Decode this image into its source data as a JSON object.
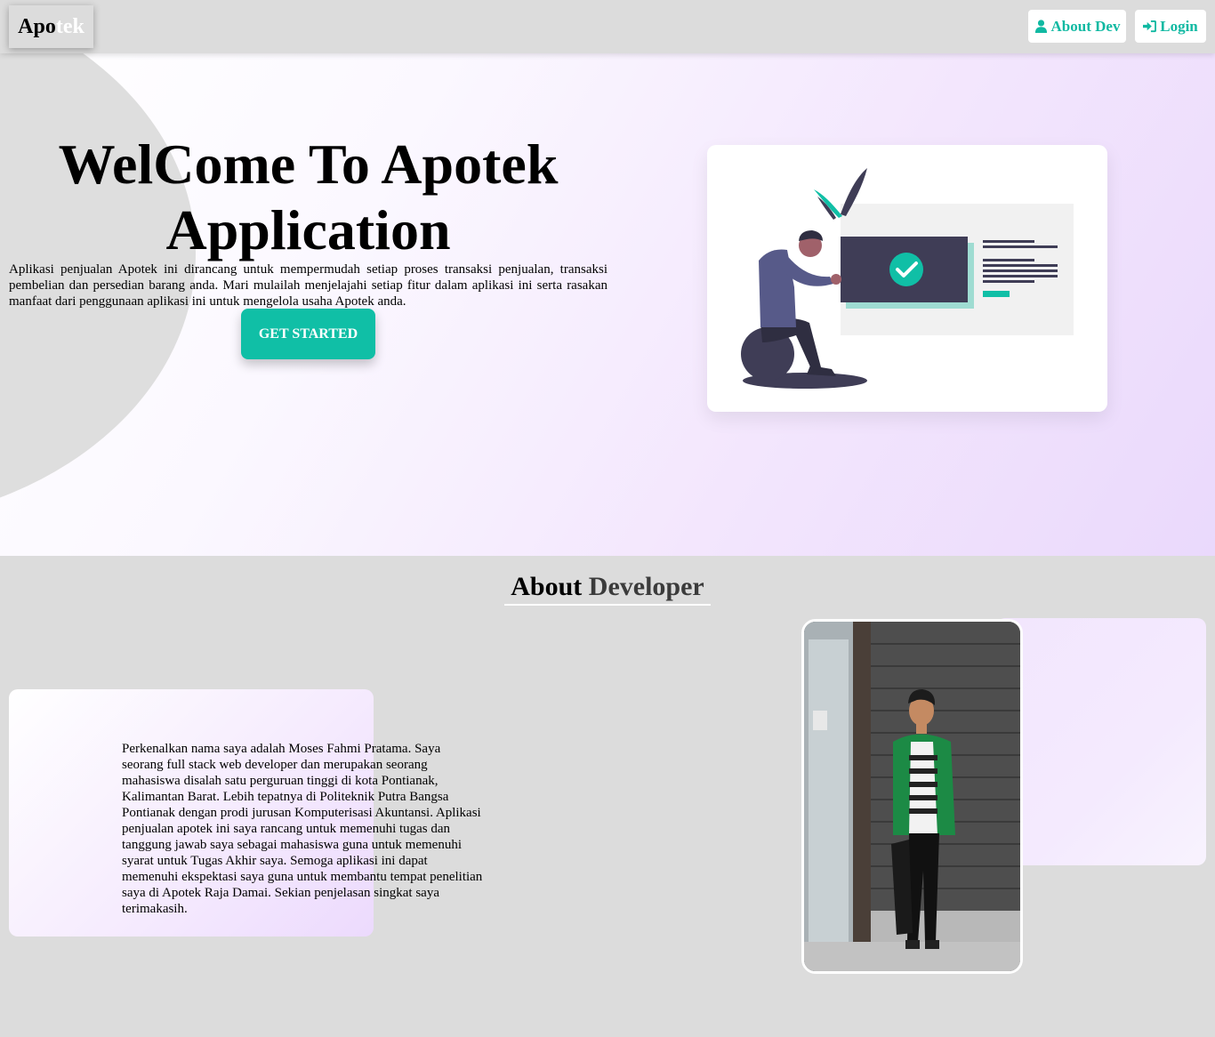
{
  "navbar": {
    "brand_part1": "Apo",
    "brand_part2": "tek",
    "about_dev_label": "About Dev",
    "login_label": "Login",
    "about_icon": "user-icon",
    "login_icon": "sign-in-icon"
  },
  "hero": {
    "title": "WelCome To Apotek Application",
    "description": "Aplikasi penjualan Apotek ini dirancang untuk mempermudah setiap proses transaksi penjualan, transaksi pembelian dan persedian barang anda. Mari mulailah menjelajahi setiap fitur dalam aplikasi ini serta rasakan manfaat dari penggunaan aplikasi ini untuk mengelola usaha Apotek anda.",
    "cta_label": "GET STARTED",
    "illustration": "person-with-approved-document-illustration"
  },
  "about": {
    "heading_part1": "About",
    "heading_part2": "Developer",
    "text": "Perkenalkan nama saya adalah Moses Fahmi Pratama. Saya seorang full stack web developer dan merupakan seorang mahasiswa disalah satu perguruan tinggi di kota Pontianak, Kalimantan Barat. Lebih tepatnya di Politeknik Putra Bangsa Pontianak dengan prodi jurusan Komputerisasi Akuntansi. Aplikasi penjualan apotek ini saya rancang untuk memenuhi tugas dan tanggung jawab saya sebagai mahasiswa guna untuk memenuhi syarat untuk Tugas Akhir saya. Semoga aplikasi ini dapat memenuhi ekspektasi saya guna untuk membantu tempat penelitian saya di Apotek Raja Damai. Sekian penjelasan singkat saya terimakasih.",
    "photo": "developer-photo"
  },
  "colors": {
    "accent": "#10bfa6",
    "navbar_bg": "#dcdcdc",
    "page_bg": "#dcdcdc",
    "hero_gradient_end": "#ead9fc"
  }
}
